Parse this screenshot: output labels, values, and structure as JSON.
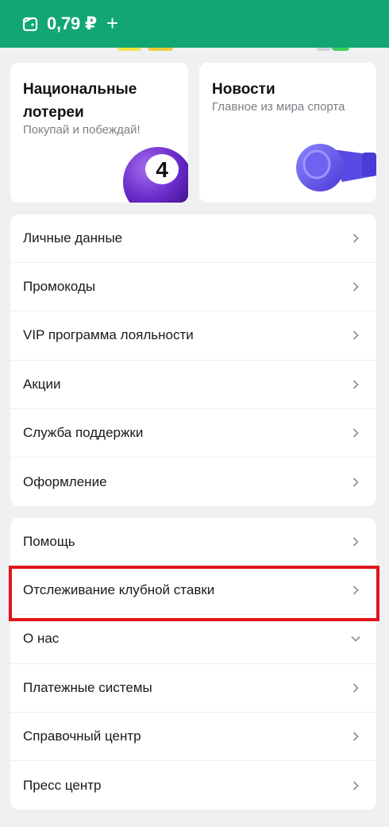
{
  "header": {
    "balance": "0,79 ₽",
    "add_label": "+",
    "wallet_icon": "wallet-icon",
    "background": "#11a672"
  },
  "promo_cards": [
    {
      "title": "Национальные лотереи",
      "subtitle": "Покупай и побеждай!",
      "icon": "lottery-ball-icon",
      "ball_number": "4"
    },
    {
      "title": "Новости",
      "subtitle": "Главное из мира спорта",
      "icon": "whistle-icon"
    }
  ],
  "menu_group_1": [
    {
      "label": "Личные данные",
      "icon": "chevron-right-icon"
    },
    {
      "label": "Промокоды",
      "icon": "chevron-right-icon"
    },
    {
      "label": "VIP программа лояльности",
      "icon": "chevron-right-icon"
    },
    {
      "label": "Акции",
      "icon": "chevron-right-icon"
    },
    {
      "label": "Служба поддержки",
      "icon": "chevron-right-icon"
    },
    {
      "label": "Оформление",
      "icon": "chevron-right-icon"
    }
  ],
  "menu_group_2": [
    {
      "label": "Помощь",
      "icon": "chevron-right-icon"
    },
    {
      "label": "Отслеживание клубной ставки",
      "icon": "chevron-right-icon"
    },
    {
      "label": "О нас",
      "icon": "chevron-down-icon"
    },
    {
      "label": "Платежные системы",
      "icon": "chevron-right-icon"
    },
    {
      "label": "Справочный центр",
      "icon": "chevron-right-icon"
    },
    {
      "label": "Пресс центр",
      "icon": "chevron-right-icon"
    }
  ],
  "colors": {
    "accent": "#11a672",
    "highlight": "#e3141b",
    "page_background": "#eef0f2"
  }
}
